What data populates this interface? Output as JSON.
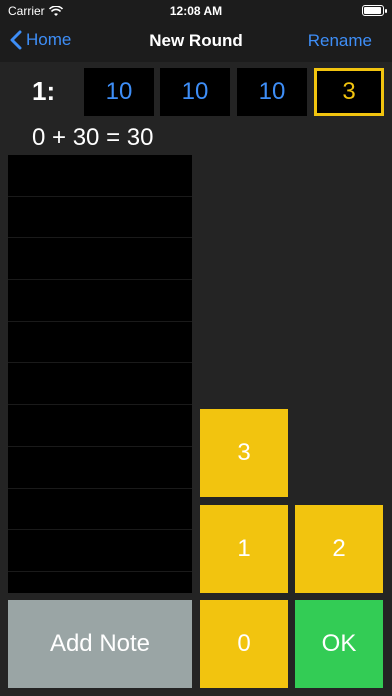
{
  "status_bar": {
    "carrier": "Carrier",
    "time": "12:08 AM"
  },
  "nav": {
    "back_label": "Home",
    "title": "New Round",
    "rename_label": "Rename"
  },
  "round": {
    "label": "1:",
    "scores": [
      "10",
      "10",
      "10",
      "3"
    ],
    "active_index": 3
  },
  "equation": "0 + 30 = 30",
  "history_rows": 10,
  "keypad": {
    "key_3": "3",
    "key_1": "1",
    "key_2": "2",
    "key_0": "0",
    "ok": "OK",
    "add_note": "Add Note"
  },
  "colors": {
    "accent_blue": "#3e8ef7",
    "key_yellow": "#f2c40f",
    "ok_green": "#33cc55",
    "note_gray": "#9aa5a5"
  }
}
